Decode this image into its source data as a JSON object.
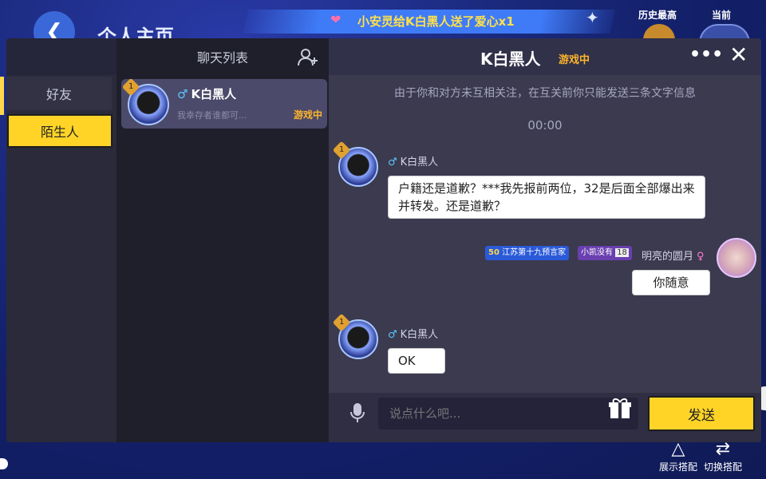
{
  "background": {
    "page_title": "个人主页",
    "banner_text": "小安灵给K白黑人送了爱心x1",
    "history_best_label": "历史最高",
    "current_label": "当前",
    "bottom_buttons": [
      "展示搭配",
      "切换搭配"
    ]
  },
  "sidebar": {
    "items": [
      {
        "label": "好友",
        "active": false
      },
      {
        "label": "陌生人",
        "active": true
      }
    ]
  },
  "chat_list": {
    "header": "聊天列表",
    "items": [
      {
        "gender": "♂",
        "name": "K白黑人",
        "preview": "我幸存者谁都可...",
        "status": "游戏中",
        "level_badge": "1"
      }
    ]
  },
  "chat": {
    "name": "K白黑人",
    "status": "游戏中",
    "notice": "由于你和对方未互相关注，在互关前你只能发送三条文字信息",
    "time": "00:00",
    "messages": [
      {
        "side": "left",
        "gender": "♂",
        "sender": "K白黑人",
        "text": "户籍还是道歉？***我先报前两位，32是后面全部爆出来并转发。还是道歉？",
        "level_badge": "1"
      },
      {
        "side": "right",
        "sender": "明亮的圆月",
        "gender": "♀",
        "tag_level": "50",
        "tag_title": "江苏第十九预言家",
        "tag_guard": "小凯没有",
        "tag_guard_level": "18",
        "text": "你随意"
      },
      {
        "side": "left",
        "gender": "♂",
        "sender": "K白黑人",
        "text": "OK",
        "level_badge": "1"
      }
    ],
    "input_placeholder": "说点什么吧...",
    "send_label": "发送"
  },
  "colors": {
    "accent": "#ffd427",
    "status": "#ffb52b",
    "male": "#5ec6ff"
  },
  "icons": [
    "back-icon",
    "add-friend-icon",
    "more-icon",
    "close-icon",
    "mic-icon",
    "gift-icon"
  ]
}
